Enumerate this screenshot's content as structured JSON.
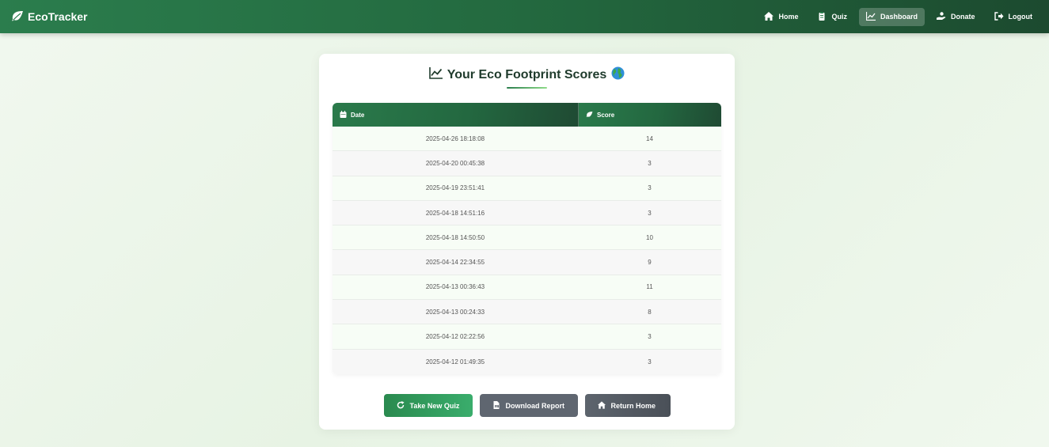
{
  "navbar": {
    "brand": "EcoTracker",
    "items": [
      {
        "label": "Home",
        "icon": "home-icon"
      },
      {
        "label": "Quiz",
        "icon": "clipboard-icon"
      },
      {
        "label": "Dashboard",
        "icon": "chart-line-icon",
        "active": true
      },
      {
        "label": "Donate",
        "icon": "hand-heart-icon"
      },
      {
        "label": "Logout",
        "icon": "sign-out-icon"
      }
    ]
  },
  "card": {
    "title": "Your Eco Footprint Scores",
    "title_icon": "chart-line-icon",
    "title_emoji": "globe-icon"
  },
  "table": {
    "columns": [
      {
        "label": "Date",
        "icon": "calendar-icon"
      },
      {
        "label": "Score",
        "icon": "leaf-icon"
      }
    ],
    "rows": [
      {
        "date": "2025-04-26 18:18:08",
        "score": "14"
      },
      {
        "date": "2025-04-20 00:45:38",
        "score": "3"
      },
      {
        "date": "2025-04-19 23:51:41",
        "score": "3"
      },
      {
        "date": "2025-04-18 14:51:16",
        "score": "3"
      },
      {
        "date": "2025-04-18 14:50:50",
        "score": "10"
      },
      {
        "date": "2025-04-14 22:34:55",
        "score": "9"
      },
      {
        "date": "2025-04-13 00:36:43",
        "score": "11"
      },
      {
        "date": "2025-04-13 00:24:33",
        "score": "8"
      },
      {
        "date": "2025-04-12 02:22:56",
        "score": "3"
      },
      {
        "date": "2025-04-12 01:49:35",
        "score": "3"
      }
    ]
  },
  "actions": {
    "take_quiz": "Take New Quiz",
    "download": "Download Report",
    "return_home": "Return Home"
  },
  "colors": {
    "brand_green": "#2b7d4d",
    "dark_green": "#1c4a2f",
    "button_gray": "#5f6670"
  }
}
